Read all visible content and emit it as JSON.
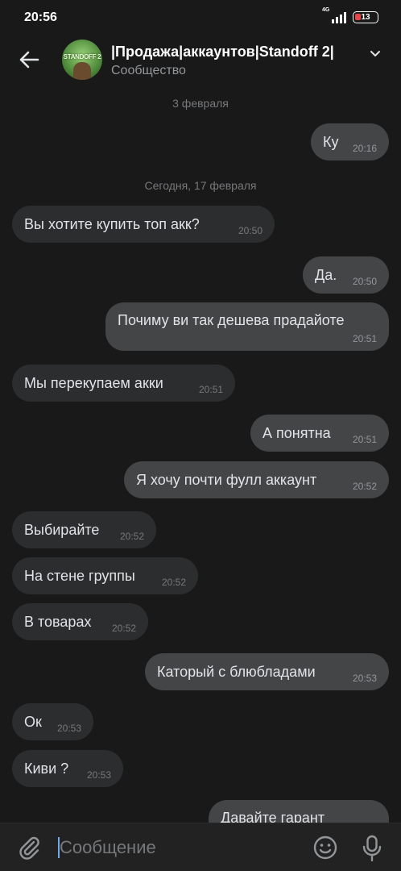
{
  "status": {
    "time": "20:56",
    "network": "4G",
    "battery": "13"
  },
  "header": {
    "title": "|Продажа|аккаунтов|Standoff 2|",
    "subtitle": "Сообщество",
    "avatar_text": "STANDOFF 2"
  },
  "dates": {
    "feb3": "3 февраля",
    "today": "Сегодня, 17 февраля"
  },
  "messages": [
    {
      "text": "Ку",
      "time": "20:16",
      "dir": "out"
    },
    {
      "text": "Вы хотите купить топ акк?",
      "time": "20:50",
      "dir": "in"
    },
    {
      "text": "Да.",
      "time": "20:50",
      "dir": "out"
    },
    {
      "text": "Почиму ви так дешева прадайоте",
      "time": "20:51",
      "dir": "out"
    },
    {
      "text": "Мы перекупаем акки",
      "time": "20:51",
      "dir": "in"
    },
    {
      "text": "А понятна",
      "time": "20:51",
      "dir": "out"
    },
    {
      "text": "Я хочу почти фулл аккаунт",
      "time": "20:52",
      "dir": "out"
    },
    {
      "text": "Выбирайте",
      "time": "20:52",
      "dir": "in"
    },
    {
      "text": "На стене группы",
      "time": "20:52",
      "dir": "in"
    },
    {
      "text": "В товарах",
      "time": "20:52",
      "dir": "in"
    },
    {
      "text": "Каторый с блюбладами",
      "time": "20:53",
      "dir": "out"
    },
    {
      "text": "Ок",
      "time": "20:53",
      "dir": "in"
    },
    {
      "text": "Киви ?",
      "time": "20:53",
      "dir": "in"
    },
    {
      "text": "Давайте гарант",
      "time": "",
      "dir": "out"
    }
  ],
  "composer": {
    "placeholder": "Сообщение"
  },
  "icons": {
    "back": "arrow-left-icon",
    "chevron": "chevron-down-icon",
    "attach": "paperclip-icon",
    "emoji": "smile-icon",
    "mic": "microphone-icon"
  },
  "colors": {
    "background": "#19191a",
    "incoming_bubble": "#2c2d2e",
    "outgoing_bubble": "#444546",
    "accent": "#71aaeb"
  }
}
